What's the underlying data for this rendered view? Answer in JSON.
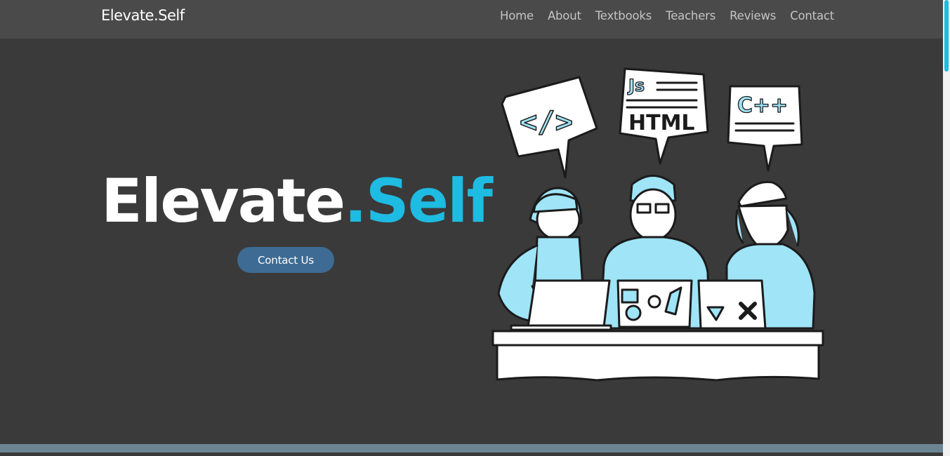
{
  "nav": {
    "brand": "Elevate.Self",
    "links": [
      "Home",
      "About",
      "Textbooks",
      "Teachers",
      "Reviews",
      "Contact"
    ]
  },
  "hero": {
    "title_main": "Elevate",
    "title_accent": ".Self",
    "cta_label": "Contact Us"
  },
  "illustration": {
    "bubble_left": "</>",
    "bubble_mid_top": "Js",
    "bubble_mid": "HTML",
    "bubble_right": "C++"
  },
  "colors": {
    "accent": "#1ebbe2",
    "background": "#3a3a3a",
    "navbar": "#4a4a4a",
    "button": "#3d6b93",
    "illustration_blue": "#9fe4f7"
  }
}
